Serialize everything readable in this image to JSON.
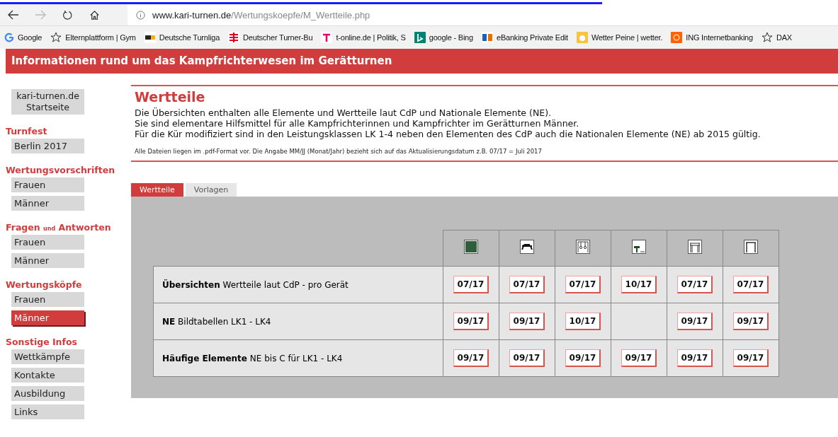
{
  "browser": {
    "nav": [
      {
        "kind": "back",
        "disabled": false
      },
      {
        "kind": "forward",
        "disabled": true
      },
      {
        "kind": "reload",
        "disabled": false
      },
      {
        "kind": "home",
        "disabled": false
      }
    ],
    "url": {
      "domain": "www.kari-turnen.de",
      "path": "/Wertungskoepfe/M_Wertteile.php"
    },
    "bookmarks": [
      {
        "kind": "google",
        "label": "Google"
      },
      {
        "kind": "star",
        "label": "Elternplattform | Gym"
      },
      {
        "kind": "dtl",
        "label": "Deutsche Turnliga"
      },
      {
        "kind": "dtb",
        "label": "Deutscher Turner-Bu"
      },
      {
        "kind": "telekom",
        "label": "t-online.de | Politik, S"
      },
      {
        "kind": "bing",
        "label": "google - Bing"
      },
      {
        "kind": "bank",
        "label": "eBanking Private Edit"
      },
      {
        "kind": "weather",
        "label": "Wetter Peine | wetter."
      },
      {
        "kind": "ing",
        "label": "ING Internetbanking"
      },
      {
        "kind": "star",
        "label": "DAX"
      }
    ]
  },
  "site_header": "Informationen rund um das Kampfrichterwesen im Gerätturnen",
  "sidebar": {
    "home_button": "kari-turnen.de Startseite",
    "sections": [
      {
        "title": "Turnfest",
        "items": [
          {
            "label": "Berlin 2017",
            "selected": false
          }
        ]
      },
      {
        "title": "Wertungsvorschriften",
        "items": [
          {
            "label": "Frauen",
            "selected": false
          },
          {
            "label": "Männer",
            "selected": false
          }
        ]
      },
      {
        "title": "Fragen $_{und}$ Antworten",
        "items": [
          {
            "label": "Frauen",
            "selected": false
          },
          {
            "label": "Männer",
            "selected": false
          }
        ]
      },
      {
        "title": "Wertungsköpfe",
        "items": [
          {
            "label": "Frauen",
            "selected": false
          },
          {
            "label": "Männer",
            "selected": true
          }
        ]
      },
      {
        "title": "Sonstige Infos",
        "items": [
          {
            "label": "Wettkämpfe",
            "selected": false
          },
          {
            "label": "Kontakte",
            "selected": false
          },
          {
            "label": "Ausbildung",
            "selected": false
          },
          {
            "label": "Links",
            "selected": false
          }
        ]
      }
    ]
  },
  "page": {
    "title": "Wertteile",
    "intro": [
      "Die Übersichten enthalten alle Elemente und Wertteile laut CdP und Nationale Elemente (NE).",
      "Sie sind elementare Hilfsmittel für alle Kampfrichterinnen und Kampfrichter im Gerätturnen Männer.",
      "Für die Kür modifiziert sind in den Leistungsklassen LK 1-4 neben den Elementen des CdP auch die Nationalen Elemente (NE) ab 2015 gültig."
    ],
    "note": "Alle Dateien liegen im .pdf-Format vor. Die Angabe MM/JJ (Monat/Jahr) bezieht sich auf das Aktualisierungsdatum z.B. 07/17 = Juli 2017",
    "tabs": [
      {
        "label": "Wertteile",
        "selected": true
      },
      {
        "label": "Vorlagen",
        "selected": false
      }
    ],
    "table": {
      "apparatus": [
        {
          "kind": "floor"
        },
        {
          "kind": "pommel"
        },
        {
          "kind": "rings"
        },
        {
          "kind": "vault"
        },
        {
          "kind": "parallel"
        },
        {
          "kind": "highbar"
        }
      ],
      "rows": [
        {
          "label": "**Übersichten** Wertteile laut CdP - pro Gerät",
          "cells": [
            "07/17",
            "07/17",
            "07/17",
            "10/17",
            "07/17",
            "07/17"
          ]
        },
        {
          "label": "**NE** Bildtabellen LK1 - LK4",
          "cells": [
            "09/17",
            "09/17",
            "10/17",
            null,
            "09/17",
            "09/17"
          ]
        },
        {
          "label": "**Häufige Elemente** NE bis C für LK1 - LK4",
          "cells": [
            "09/17",
            "09/17",
            "09/17",
            "09/17",
            "09/17",
            "09/17"
          ]
        }
      ]
    }
  }
}
